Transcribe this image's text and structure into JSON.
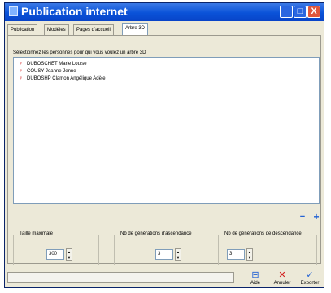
{
  "window": {
    "title": "Publication internet"
  },
  "window_controls": [
    "_",
    "□",
    "X"
  ],
  "tabs": [
    "Publication",
    "Modèles",
    "Pages d'accueil",
    "Arbre 3D"
  ],
  "instruction": "Sélectionnez les personnes pour qui vous voulez un arbre 3D",
  "persons": [
    "DUBOSCHET Marie Louise",
    "COUSY Jeanne Jenne",
    "DUBOSHP Clamon Angélique Adèle"
  ],
  "list_controls": {
    "minus": "−",
    "plus": "+"
  },
  "settings": {
    "max_size": {
      "label": "Taille maximale",
      "value": "300"
    },
    "ascendance": {
      "label": "Nb de générations d'ascendance",
      "value": "3"
    },
    "descendance": {
      "label": "Nb de générations de descendance",
      "value": "3"
    }
  },
  "actions": {
    "help": "Aide",
    "cancel": "Annuler",
    "export": "Exporter"
  },
  "colors": {
    "titlebar": "#0a52d8",
    "window_bg": "#ece9d8",
    "pin": "#d21a1a",
    "accent": "#1e5fd4"
  },
  "icons": [
    "app-icon",
    "person-pin-icon",
    "help-icon",
    "cancel-icon",
    "export-icon"
  ]
}
